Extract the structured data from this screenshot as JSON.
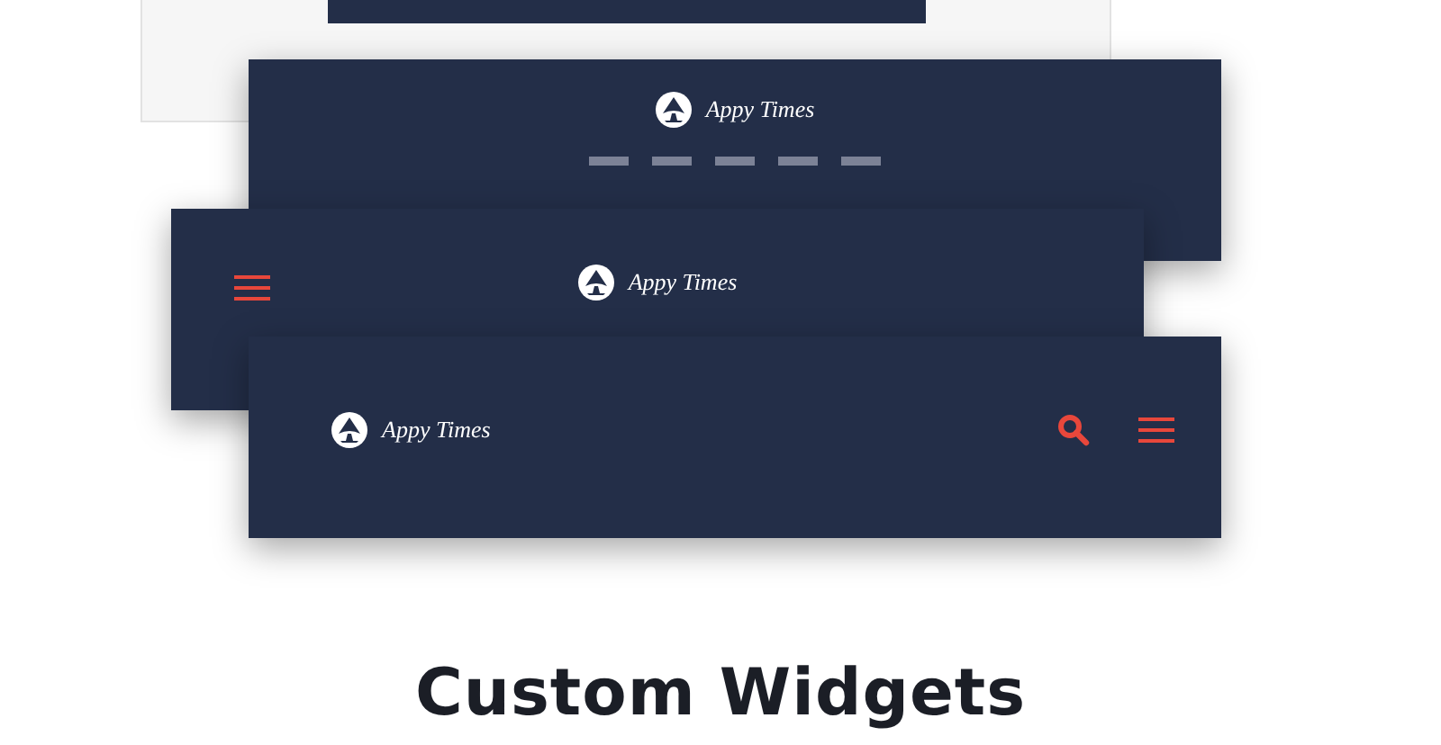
{
  "headers": [
    {
      "kind": "centered-nav",
      "logo_text": "Appy Times"
    },
    {
      "kind": "menu-left",
      "logo_text": "Appy Times"
    },
    {
      "kind": "logo-left-actions",
      "logo_text": "Appy Times"
    }
  ],
  "heading": "Custom Widgets"
}
